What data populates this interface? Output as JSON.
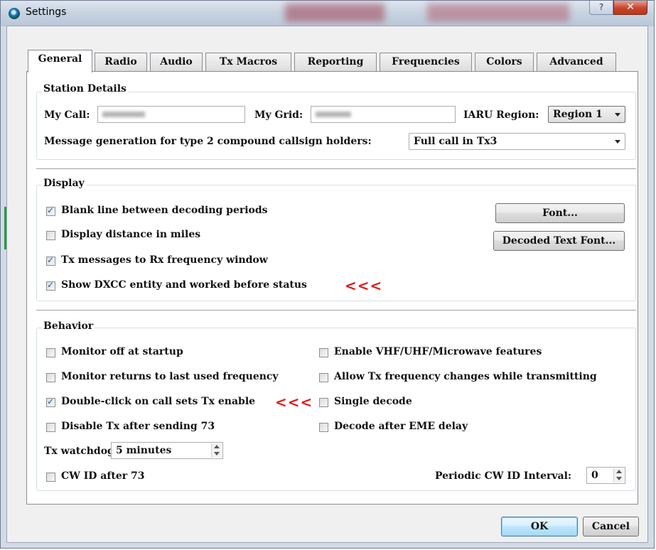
{
  "window": {
    "title": "Settings",
    "help_glyph": "?",
    "close_glyph": "✕"
  },
  "tabs": [
    {
      "label": "General"
    },
    {
      "label": "Radio"
    },
    {
      "label": "Audio"
    },
    {
      "label": "Tx Macros"
    },
    {
      "label": "Reporting"
    },
    {
      "label": "Frequencies"
    },
    {
      "label": "Colors"
    },
    {
      "label": "Advanced"
    }
  ],
  "station": {
    "title": "Station Details",
    "my_call_label": "My Call:",
    "my_grid_label": "My Grid:",
    "iaru_label": "IARU Region:",
    "iaru_value": "Region 1",
    "msg_gen_label": "Message generation for type 2 compound callsign holders:",
    "msg_gen_value": "Full call in Tx3"
  },
  "display": {
    "title": "Display",
    "options": [
      {
        "label": "Blank line between decoding periods",
        "checked": true
      },
      {
        "label": "Display distance in miles",
        "checked": false
      },
      {
        "label": "Tx messages to Rx frequency window",
        "checked": true
      },
      {
        "label": "Show DXCC entity and worked before status",
        "checked": true
      }
    ],
    "font_button": "Font...",
    "decoded_font_button": "Decoded Text Font...",
    "annotation": "<<<"
  },
  "behavior": {
    "title": "Behavior",
    "left_options": [
      {
        "label": "Monitor off at startup",
        "checked": false
      },
      {
        "label": "Monitor returns to last used frequency",
        "checked": false
      },
      {
        "label": "Double-click on call sets Tx enable",
        "checked": true
      },
      {
        "label": "Disable Tx after sending 73",
        "checked": false
      }
    ],
    "right_options": [
      {
        "label": "Enable VHF/UHF/Microwave features",
        "checked": false
      },
      {
        "label": "Allow Tx frequency changes while transmitting",
        "checked": false
      },
      {
        "label": "Single decode",
        "checked": false
      },
      {
        "label": "Decode after EME delay",
        "checked": false
      }
    ],
    "annotation": "<<<",
    "watchdog_label": "Tx watchdog:",
    "watchdog_value": "5 minutes",
    "cwid_label": "CW ID after 73",
    "cwid_checked": false,
    "periodic_label": "Periodic CW ID Interval:",
    "periodic_value": "0"
  },
  "footer": {
    "ok": "OK",
    "cancel": "Cancel"
  },
  "colors": {
    "annotation": "#e31b1b",
    "default_button_border": "#3c7fb1"
  },
  "icons": {
    "app": "wsjt-app-icon",
    "help": "help-icon",
    "close": "close-icon"
  }
}
